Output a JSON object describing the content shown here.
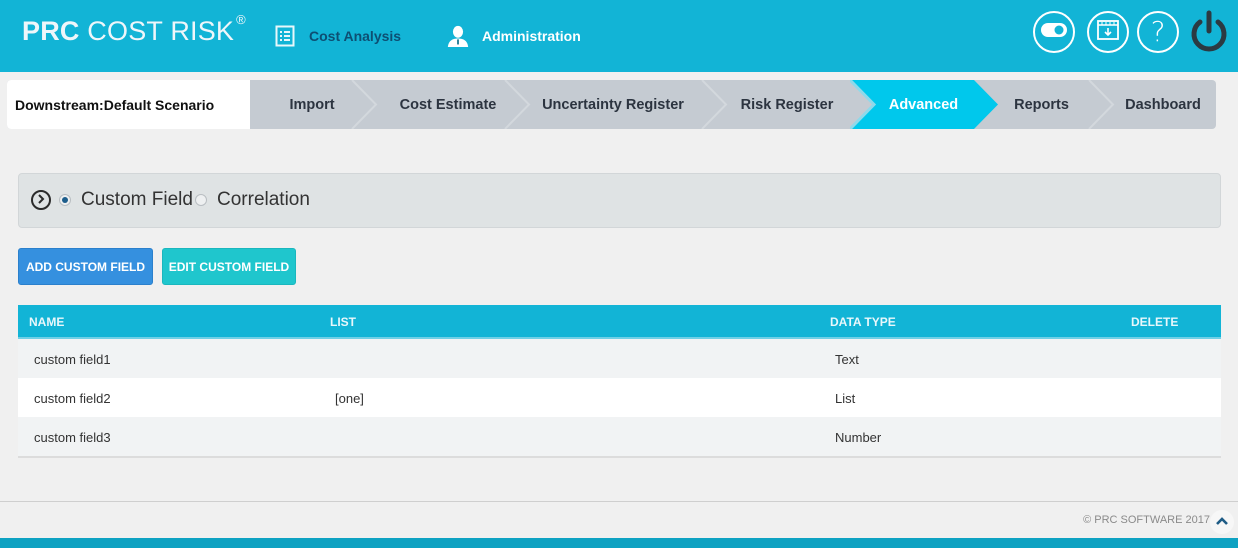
{
  "header": {
    "logo_bold": "PRC",
    "logo_rest": " COST RISK",
    "logo_mark": "®",
    "nav": [
      {
        "label": "Cost Analysis",
        "icon": "list-document-icon"
      },
      {
        "label": "Administration",
        "icon": "user-icon"
      }
    ],
    "tools": [
      {
        "name": "toggle-icon"
      },
      {
        "name": "download-window-icon"
      },
      {
        "name": "help-icon",
        "glyph": "?"
      },
      {
        "name": "power-icon"
      }
    ]
  },
  "breadcrumb": {
    "project": "Downstream",
    "separator": ":",
    "scenario": "Default Scenario",
    "steps": [
      "Import",
      "Cost Estimate",
      "Uncertainty Register",
      "Risk Register",
      "Advanced",
      "Reports",
      "Dashboard"
    ],
    "active_step": "Advanced"
  },
  "panel": {
    "options": [
      {
        "label": "Custom Field",
        "selected": true
      },
      {
        "label": "Correlation",
        "selected": false
      }
    ]
  },
  "buttons": {
    "add": "ADD CUSTOM FIELD",
    "edit": "EDIT CUSTOM FIELD"
  },
  "table": {
    "columns": [
      "NAME",
      "LIST",
      "DATA TYPE",
      "DELETE"
    ],
    "rows": [
      {
        "name": "custom field1",
        "list": "",
        "data_type": "Text",
        "delete": ""
      },
      {
        "name": "custom field2",
        "list": "[one]",
        "data_type": "List",
        "delete": ""
      },
      {
        "name": "custom field3",
        "list": "",
        "data_type": "Number",
        "delete": ""
      }
    ]
  },
  "footer": {
    "copyright": "© PRC SOFTWARE 2017"
  },
  "colors": {
    "brand": "#12b4d6",
    "active_step": "#00c8ec",
    "add_button": "#3590df",
    "edit_button": "#1fc6cd"
  }
}
